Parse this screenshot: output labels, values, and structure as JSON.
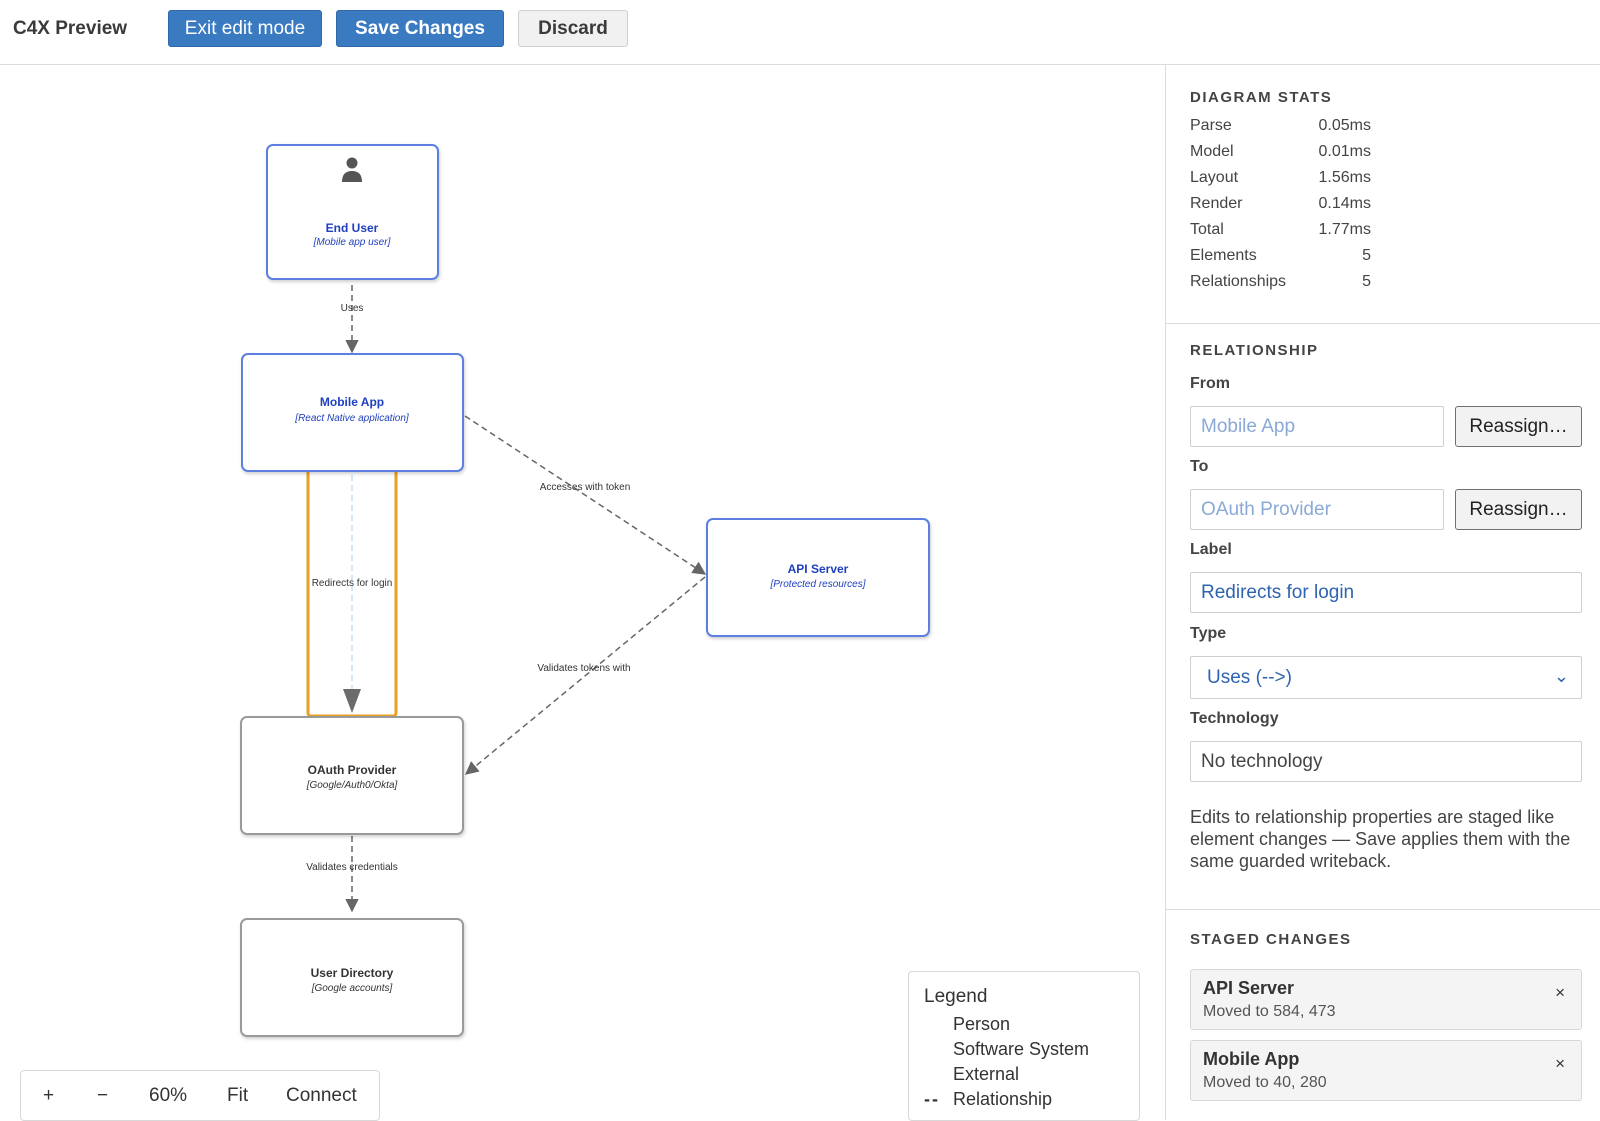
{
  "toolbar": {
    "title": "C4X Preview",
    "exit_label": "Exit edit mode",
    "save_label": "Save Changes",
    "discard_label": "Discard"
  },
  "diagram": {
    "nodes": {
      "end_user": {
        "title": "End User",
        "tech": "[Mobile app user]",
        "kind": "person"
      },
      "mobile_app": {
        "title": "Mobile App",
        "tech": "[React Native application]",
        "kind": "software-system"
      },
      "api_server": {
        "title": "API Server",
        "tech": "[Protected resources]",
        "kind": "software-system"
      },
      "oauth": {
        "title": "OAuth Provider",
        "tech": "[Google/Auth0/Okta]",
        "kind": "external"
      },
      "user_dir": {
        "title": "User Directory",
        "tech": "[Google accounts]",
        "kind": "external"
      }
    },
    "edges": {
      "uses": "Uses",
      "accesses": "Accesses with token",
      "redirects": "Redirects for login",
      "validates_tokens": "Validates tokens with",
      "validates_creds": "Validates credentials"
    },
    "colors": {
      "internal_border": "#5b7fe0",
      "internal_text": "#1f3fbf",
      "external_border": "#9a9a9a",
      "external_text": "#333333",
      "selection": "#e8a020",
      "edge": "#666666"
    }
  },
  "zoom": {
    "plus": "+",
    "minus": "−",
    "level": "60%",
    "fit": "Fit",
    "connect": "Connect"
  },
  "legend": {
    "title": "Legend",
    "items": [
      "Person",
      "Software System",
      "External",
      "Relationship"
    ],
    "dash": "--"
  },
  "stats": {
    "header": "DIAGRAM STATS",
    "rows": [
      {
        "label": "Parse",
        "value": "0.05ms"
      },
      {
        "label": "Model",
        "value": "0.01ms"
      },
      {
        "label": "Layout",
        "value": "1.56ms"
      },
      {
        "label": "Render",
        "value": "0.14ms"
      },
      {
        "label": "Total",
        "value": "1.77ms"
      },
      {
        "label": "Elements",
        "value": "5"
      },
      {
        "label": "Relationships",
        "value": "5"
      }
    ]
  },
  "relationship": {
    "header": "RELATIONSHIP",
    "from_label": "From",
    "from_value": "Mobile App",
    "to_label": "To",
    "to_value": "OAuth Provider",
    "reassign_label": "Reassign…",
    "label_label": "Label",
    "label_value": "Redirects for login",
    "type_label": "Type",
    "type_value": "Uses (-->)",
    "tech_label": "Technology",
    "tech_placeholder": "No technology",
    "help": "Edits to relationship properties are staged like element changes — Save applies them with the same guarded writeback."
  },
  "staged": {
    "header": "STAGED CHANGES",
    "items": [
      {
        "title": "API Server",
        "detail": "Moved to 584, 473",
        "close": "×"
      },
      {
        "title": "Mobile App",
        "detail": "Moved to 40, 280",
        "close": "×"
      }
    ]
  }
}
